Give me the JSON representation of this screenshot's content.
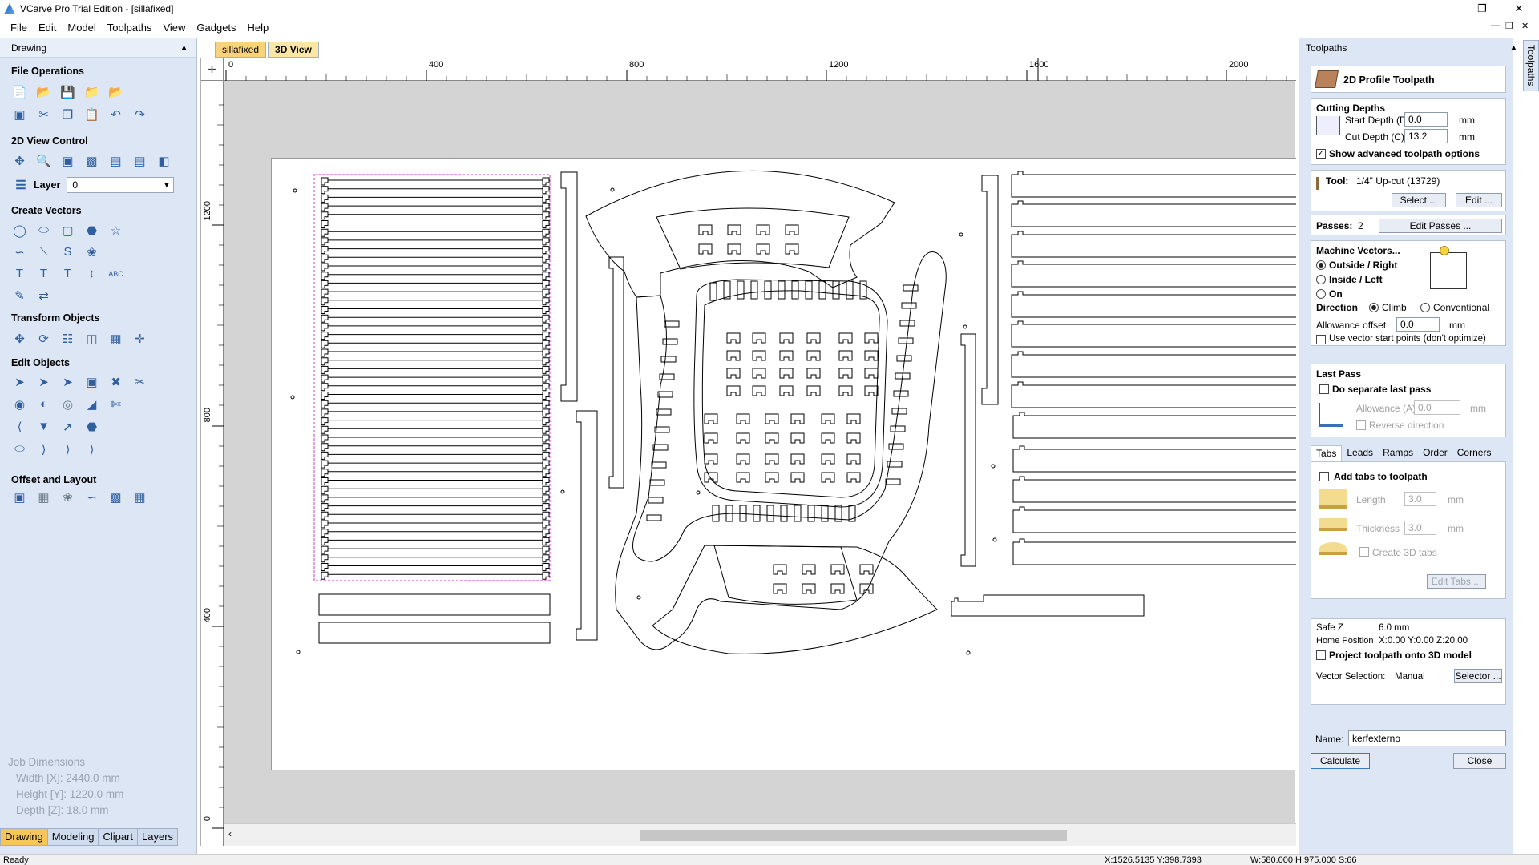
{
  "window": {
    "title": "VCarve Pro Trial Edition - [sillafixed]"
  },
  "menu": [
    "File",
    "Edit",
    "Model",
    "Toolpaths",
    "View",
    "Gadgets",
    "Help"
  ],
  "left_panel": {
    "title": "Drawing",
    "sections": {
      "file_operations": "File Operations",
      "view_control": "2D View Control",
      "create_vectors": "Create Vectors",
      "transform_objects": "Transform Objects",
      "edit_objects": "Edit Objects",
      "offset_layout": "Offset and Layout"
    },
    "layer_label": "Layer",
    "layer_value": "0",
    "job_dimensions": {
      "heading": "Job Dimensions",
      "width": "Width  [X]: 2440.0 mm",
      "height": "Height [Y]: 1220.0 mm",
      "depth": "Depth  [Z]: 18.0 mm"
    },
    "bottom_tabs": [
      "Drawing",
      "Modeling",
      "Clipart",
      "Layers"
    ]
  },
  "doc_tabs": [
    "sillafixed",
    "3D View"
  ],
  "rulers": {
    "horizontal": [
      "0",
      "400",
      "800",
      "1200",
      "1600",
      "2000"
    ],
    "vertical": [
      "1200",
      "800",
      "400",
      "0"
    ]
  },
  "toolpaths_panel": {
    "title": "Toolpaths",
    "side_tab": "Toolpaths",
    "header": "2D Profile Toolpath",
    "cutting_depths": {
      "title": "Cutting Depths",
      "start_label": "Start Depth (D)",
      "start_value": "0.0",
      "cut_label": "Cut Depth (C)",
      "cut_value": "13.2",
      "unit": "mm",
      "advanced_label": "Show advanced toolpath options"
    },
    "tool": {
      "label": "Tool:",
      "value": "1/4\" Up-cut (13729)",
      "select_button": "Select ...",
      "edit_button": "Edit ..."
    },
    "passes": {
      "label": "Passes:",
      "value": "2",
      "button": "Edit Passes ..."
    },
    "machine_vectors": {
      "title": "Machine Vectors...",
      "outside": "Outside / Right",
      "inside": "Inside / Left",
      "on": "On",
      "direction_label": "Direction",
      "climb": "Climb",
      "conventional": "Conventional",
      "allowance_label": "Allowance offset",
      "allowance_value": "0.0",
      "unit": "mm",
      "start_points_label": "Use vector start points (don't optimize)"
    },
    "last_pass": {
      "title": "Last Pass",
      "separate_label": "Do separate last pass",
      "allowance_label": "Allowance (A)",
      "allowance_value": "0.0",
      "unit": "mm",
      "reverse_label": "Reverse direction"
    },
    "tabs": [
      "Tabs",
      "Leads",
      "Ramps",
      "Order",
      "Corners"
    ],
    "tabs_section": {
      "add_label": "Add tabs to toolpath",
      "length_label": "Length",
      "length_value": "3.0",
      "thickness_label": "Thickness",
      "thickness_value": "3.0",
      "unit": "mm",
      "create3d_label": "Create 3D tabs",
      "edit_button": "Edit Tabs ..."
    },
    "safe_z_label": "Safe Z",
    "safe_z_value": "6.0 mm",
    "home_label": "Home Position",
    "home_value": "X:0.00 Y:0.00 Z:20.00",
    "project_label": "Project toolpath onto 3D model",
    "vector_selection_label": "Vector Selection:",
    "vector_selection_value": "Manual",
    "selector_button": "Selector ...",
    "name_label": "Name:",
    "name_value": "kerfexterno",
    "calculate_button": "Calculate",
    "close_button": "Close"
  },
  "status": {
    "left": "Ready",
    "coords": "X:1526.5135 Y:398.7393",
    "size": "W:580.000   H:975.000  S:66"
  }
}
